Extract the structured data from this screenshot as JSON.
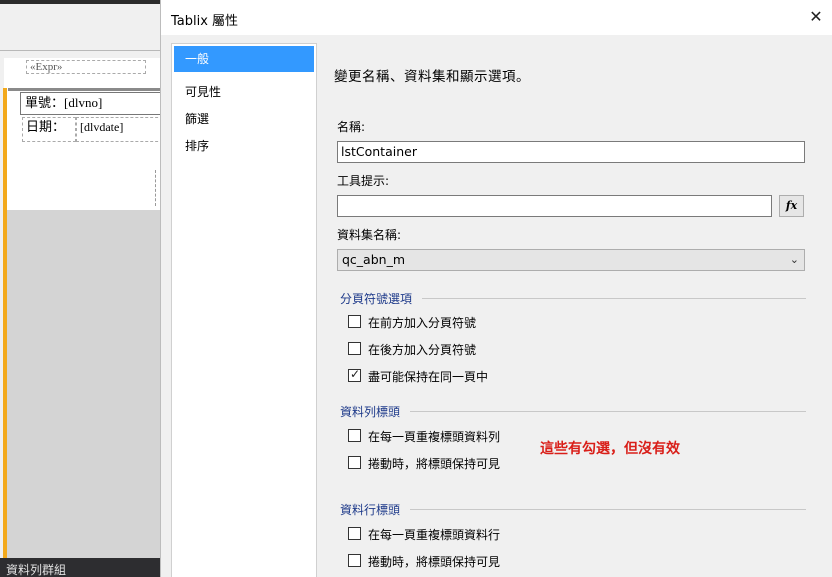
{
  "designer": {
    "ghost_text": "«Expr»",
    "order_no": "單號：[dlvno]",
    "date_label": "日期：",
    "date_value": "[dlvdate]",
    "bottom_panel_title": "資料列群組"
  },
  "dialog": {
    "title": "Tablix 屬性",
    "close_symbol": "✕",
    "nav": {
      "items": [
        {
          "label": "一般",
          "selected": true
        },
        {
          "label": "可見性",
          "selected": false
        },
        {
          "label": "篩選",
          "selected": false
        },
        {
          "label": "排序",
          "selected": false
        }
      ]
    },
    "general": {
      "heading": "變更名稱、資料集和顯示選項。",
      "name_label": "名稱:",
      "name_value": "lstContainer",
      "tooltip_label": "工具提示:",
      "tooltip_value": "",
      "fx_label": "fx",
      "dataset_label": "資料集名稱:",
      "dataset_value": "qc_abn_m",
      "page_break_group": "分頁符號選項",
      "page_break_options": [
        {
          "label": "在前方加入分頁符號",
          "checked": false
        },
        {
          "label": "在後方加入分頁符號",
          "checked": false
        },
        {
          "label": "盡可能保持在同一頁中",
          "checked": true
        }
      ],
      "row_header_group": "資料列標頭",
      "row_header_options": [
        {
          "label": "在每一頁重複標頭資料列",
          "checked": false
        },
        {
          "label": "捲動時，將標頭保持可見",
          "checked": false
        }
      ],
      "column_header_group": "資料行標頭",
      "column_header_options": [
        {
          "label": "在每一頁重複標頭資料行",
          "checked": false
        },
        {
          "label": "捲動時，將標頭保持可見",
          "checked": false
        }
      ],
      "annotation": "這些有勾選，但沒有效",
      "annotation_color": "#d91e18"
    }
  }
}
